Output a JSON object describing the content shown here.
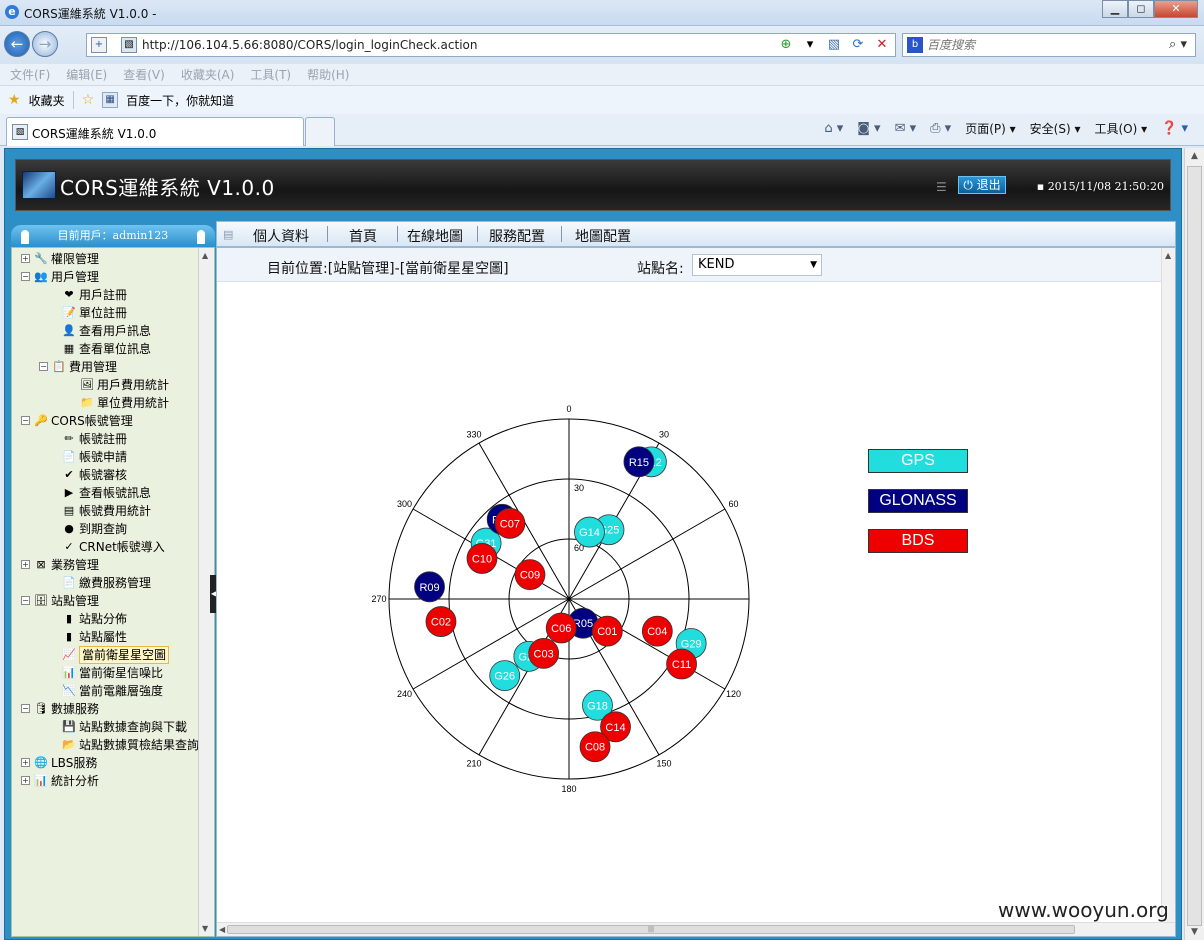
{
  "window": {
    "title": "CORS運維系統 V1.0.0 -"
  },
  "address": {
    "url": "http://106.104.5.66:8080/CORS/login_loginCheck.action",
    "search_placeholder": "百度搜索"
  },
  "menu": [
    "文件(F)",
    "编辑(E)",
    "查看(V)",
    "收藏夹(A)",
    "工具(T)",
    "帮助(H)"
  ],
  "favorites": {
    "label": "收藏夹",
    "item": "百度一下，你就知道"
  },
  "tab": {
    "label": "CORS運維系統 V1.0.0"
  },
  "commands": [
    "页面(P) ▾",
    "安全(S) ▾",
    "工具(O) ▾"
  ],
  "app": {
    "title": "CORS運維系統  V1.0.0",
    "logout": "退出",
    "datetime": "2015/11/08 21:50:20",
    "user": "目前用戶：admin123"
  },
  "nav": [
    "個人資料",
    "首頁",
    "在線地圖",
    "服務配置",
    "地圖配置"
  ],
  "tree": [
    {
      "label": "權限管理",
      "level": 0,
      "pm": "+",
      "icon": "🔧"
    },
    {
      "label": "用戶管理",
      "level": 0,
      "pm": "−",
      "icon": "👥"
    },
    {
      "label": "用戶註冊",
      "level": 1,
      "icon": "❤"
    },
    {
      "label": "單位註冊",
      "level": 1,
      "icon": "📝"
    },
    {
      "label": "查看用戶訊息",
      "level": 1,
      "icon": "👤"
    },
    {
      "label": "查看單位訊息",
      "level": 1,
      "icon": "▦"
    },
    {
      "label": "費用管理",
      "level": 1,
      "pm": "−",
      "icon": "📋"
    },
    {
      "label": "用戶費用統計",
      "level": 2,
      "icon": "🖼"
    },
    {
      "label": "單位費用統計",
      "level": 2,
      "icon": "📁"
    },
    {
      "label": "CORS帳號管理",
      "level": 0,
      "pm": "−",
      "icon": "🔑"
    },
    {
      "label": "帳號註冊",
      "level": 1,
      "icon": "✏"
    },
    {
      "label": "帳號申請",
      "level": 1,
      "icon": "📄"
    },
    {
      "label": "帳號審核",
      "level": 1,
      "icon": "✔"
    },
    {
      "label": "查看帳號訊息",
      "level": 1,
      "icon": "▶"
    },
    {
      "label": "帳號費用統計",
      "level": 1,
      "icon": "▤"
    },
    {
      "label": "到期查詢",
      "level": 1,
      "icon": "●"
    },
    {
      "label": "CRNet帳號導入",
      "level": 1,
      "icon": "✓"
    },
    {
      "label": "業務管理",
      "level": 0,
      "pm": "+",
      "icon": "⊠"
    },
    {
      "label": "繳費服務管理",
      "level": 1,
      "icon": "📄"
    },
    {
      "label": "站點管理",
      "level": 0,
      "pm": "−",
      "icon": "🗄"
    },
    {
      "label": "站點分佈",
      "level": 1,
      "icon": "▮"
    },
    {
      "label": "站點屬性",
      "level": 1,
      "icon": "▮"
    },
    {
      "label": "當前衛星星空圖",
      "level": 1,
      "icon": "📈",
      "selected": true
    },
    {
      "label": "當前衛星信噪比",
      "level": 1,
      "icon": "📊"
    },
    {
      "label": "當前電離層強度",
      "level": 1,
      "icon": "📉"
    },
    {
      "label": "數據服務",
      "level": 0,
      "pm": "−",
      "icon": "🛢"
    },
    {
      "label": "站點數據查詢與下載",
      "level": 1,
      "icon": "💾"
    },
    {
      "label": "站點數據質檢結果查詢",
      "level": 1,
      "icon": "📂"
    },
    {
      "label": "LBS服務",
      "level": 0,
      "pm": "+",
      "icon": "🌐"
    },
    {
      "label": "統計分析",
      "level": 0,
      "pm": "+",
      "icon": "📊"
    }
  ],
  "content": {
    "breadcrumb": "目前位置:[站點管理]-[當前衛星星空圖]",
    "station_label": "站點名:",
    "station_value": "KEND"
  },
  "chart_data": {
    "type": "scatter",
    "projection": "polar-skyplot",
    "radial_rings": [
      0,
      30,
      60
    ],
    "ring_labels": [
      "30",
      "60"
    ],
    "azimuth_labels": [
      "0",
      "30",
      "60",
      "90",
      "120",
      "150",
      "180",
      "210",
      "240",
      "270",
      "300",
      "330"
    ],
    "series": [
      {
        "name": "GPS",
        "color": "#22dddd",
        "points": [
          {
            "id": "G12",
            "az": 31,
            "el": 10
          },
          {
            "id": "G25",
            "az": 30,
            "el": 50
          },
          {
            "id": "G14",
            "az": 17,
            "el": 55
          },
          {
            "id": "G31",
            "az": 304,
            "el": 40
          },
          {
            "id": "G29",
            "az": 110,
            "el": 25
          },
          {
            "id": "G26",
            "az": 220,
            "el": 40
          },
          {
            "id": "G18",
            "az": 165,
            "el": 35
          },
          {
            "id": "G21",
            "az": 215,
            "el": 55
          }
        ]
      },
      {
        "name": "GLONASS",
        "color": "#000080",
        "points": [
          {
            "id": "R15",
            "az": 27,
            "el": 13
          },
          {
            "id": "R16",
            "az": 320,
            "el": 38
          },
          {
            "id": "R09",
            "az": 275,
            "el": 20
          },
          {
            "id": "R05",
            "az": 150,
            "el": 76
          }
        ]
      },
      {
        "name": "BDS",
        "color": "#ee0000",
        "points": [
          {
            "id": "C07",
            "az": 322,
            "el": 42
          },
          {
            "id": "C10",
            "az": 295,
            "el": 42
          },
          {
            "id": "C09",
            "az": 302,
            "el": 67
          },
          {
            "id": "C02",
            "az": 260,
            "el": 25
          },
          {
            "id": "C06",
            "az": 195,
            "el": 75
          },
          {
            "id": "C03",
            "az": 205,
            "el": 60
          },
          {
            "id": "C01",
            "az": 130,
            "el": 65
          },
          {
            "id": "C04",
            "az": 110,
            "el": 43
          },
          {
            "id": "C11",
            "az": 120,
            "el": 25
          },
          {
            "id": "C14",
            "az": 160,
            "el": 22
          },
          {
            "id": "C08",
            "az": 170,
            "el": 15
          }
        ]
      }
    ],
    "legend": [
      "GPS",
      "GLONASS",
      "BDS"
    ],
    "legend_placement": "right"
  },
  "watermark": "www.wooyun.org"
}
